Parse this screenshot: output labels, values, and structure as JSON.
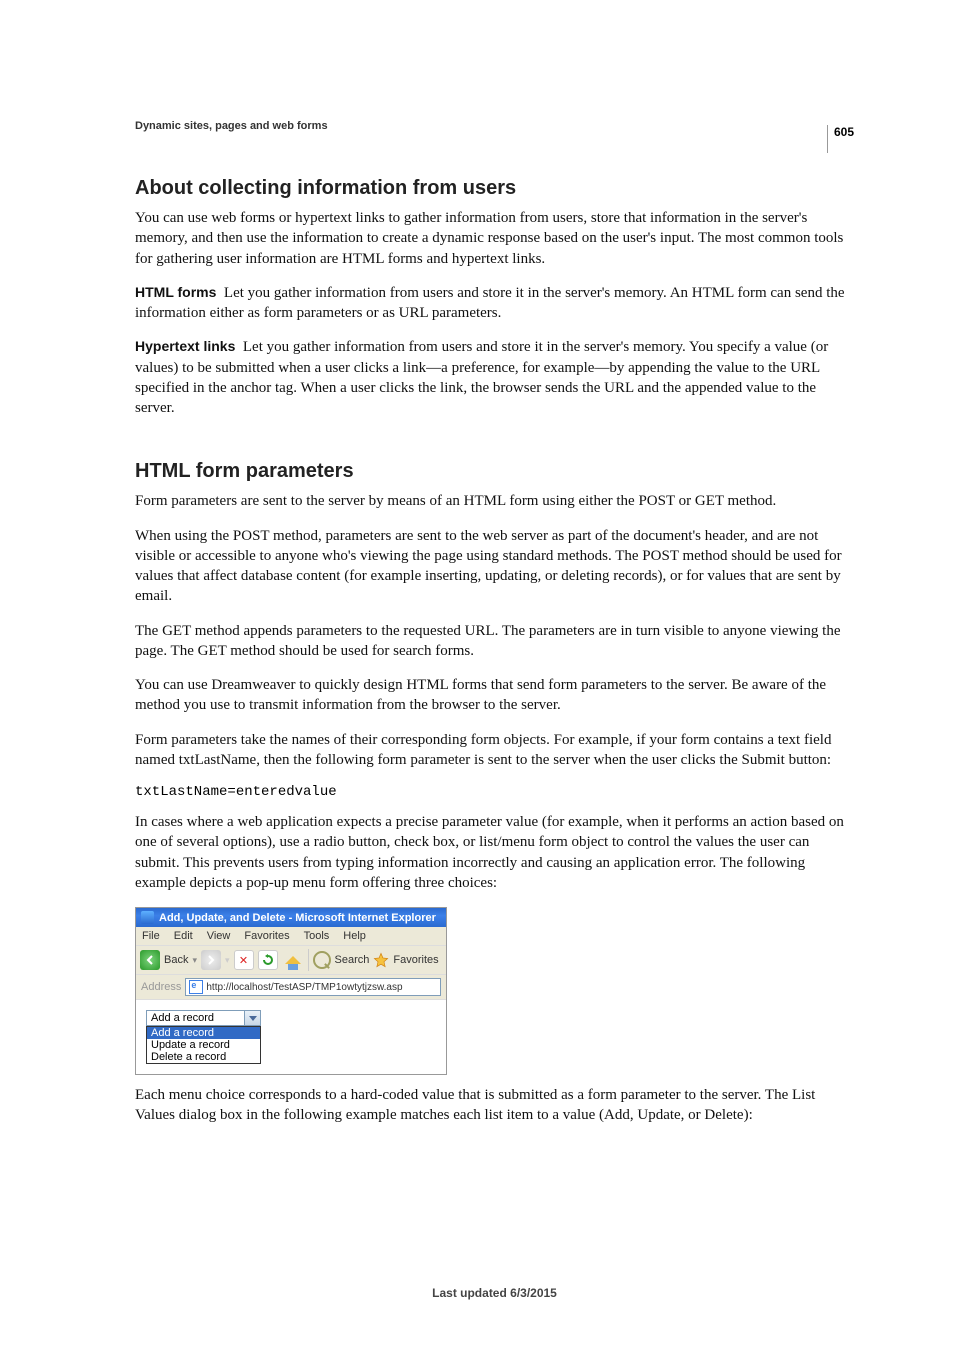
{
  "page_number": "605",
  "header": "Dynamic sites, pages and web forms",
  "section1": {
    "heading": "About collecting information from users",
    "p1": "You can use web forms or hypertext links to gather information from users, store that information in the server's memory, and then use the information to create a dynamic response based on the user's input. The most common tools for gathering user information are HTML forms and hypertext links.",
    "forms_label": "HTML forms",
    "forms_text": "Let you gather information from users and store it in the server's memory. An HTML form can send the information either as form parameters or as URL parameters.",
    "links_label": "Hypertext links",
    "links_text": "Let you gather information from users and store it in the server's memory. You specify a value (or values) to be submitted when a user clicks a link—a preference, for example—by appending the value to the URL specified in the anchor tag. When a user clicks the link, the browser sends the URL and the appended value to the server."
  },
  "section2": {
    "heading": "HTML form parameters",
    "p1": "Form parameters are sent to the server by means of an HTML form using either the POST or GET method.",
    "p2": "When using the POST method, parameters are sent to the web server as part of the document's header, and are not visible or accessible to anyone who's viewing the page using standard methods. The POST method should be used for values that affect database content (for example inserting, updating, or deleting records), or for values that are sent by email.",
    "p3": "The GET method appends parameters to the requested URL. The parameters are in turn visible to anyone viewing the page. The GET method should be used for search forms.",
    "p4": "You can use Dreamweaver to quickly design HTML forms that send form parameters to the server. Be aware of the method you use to transmit information from the browser to the server.",
    "p5": "Form parameters take the names of their corresponding form objects. For example, if your form contains a text field named txtLastName, then the following form parameter is sent to the server when the user clicks the Submit button:",
    "code": "txtLastName=enteredvalue",
    "p6": "In cases where a web application expects a precise parameter value (for example, when it performs an action based on one of several options), use a radio button, check box, or list/menu form object to control the values the user can submit. This prevents users from typing information incorrectly and causing an application error. The following example depicts a pop-up menu form offering three choices:",
    "p7": "Each menu choice corresponds to a hard-coded value that is submitted as a form parameter to the server. The List Values dialog box in the following example matches each list item to a value (Add, Update, or Delete):"
  },
  "ie": {
    "title": "Add, Update, and Delete - Microsoft Internet Explorer",
    "menu": [
      "File",
      "Edit",
      "View",
      "Favorites",
      "Tools",
      "Help"
    ],
    "back": "Back",
    "search": "Search",
    "favorites": "Favorites",
    "address_label": "Address",
    "address": "http://localhost/TestASP/TMP1owtytjzsw.asp",
    "combo_selected": "Add a record",
    "options": [
      "Add a record",
      "Update a record",
      "Delete a record"
    ]
  },
  "footer": "Last updated 6/3/2015"
}
